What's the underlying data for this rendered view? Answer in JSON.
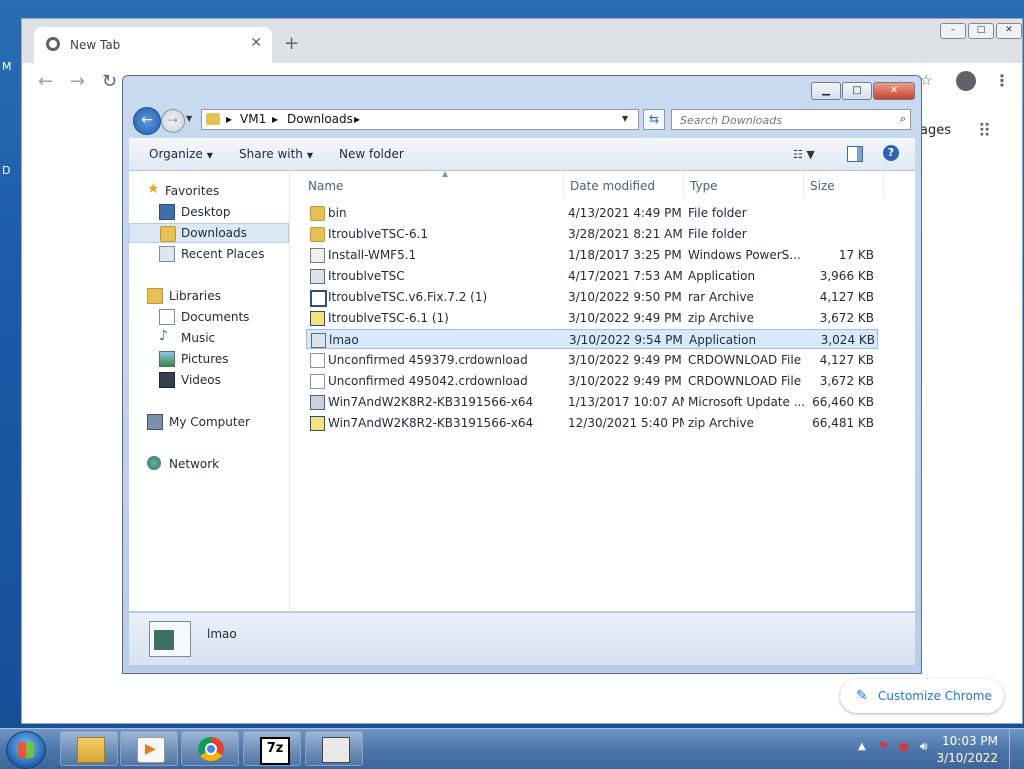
{
  "desktop": {
    "edge_letters": [
      "M",
      "D"
    ]
  },
  "chrome": {
    "tab_title": "New Tab",
    "tab_close": "✕",
    "new_tab": "+",
    "images_link": "ages",
    "customize_label": "Customize Chrome",
    "window_buttons": [
      "–",
      "□",
      "✕"
    ]
  },
  "explorer": {
    "window_buttons": {
      "minimize": "▁",
      "maximize": "□",
      "close": "✕"
    },
    "breadcrumb": [
      "VM1",
      "Downloads"
    ],
    "search_placeholder": "Search Downloads",
    "commands": {
      "organize": "Organize",
      "share_with": "Share with",
      "new_folder": "New folder"
    },
    "help": "?",
    "nav": {
      "favorites": "Favorites",
      "desktop": "Desktop",
      "downloads": "Downloads",
      "recent_places": "Recent Places",
      "libraries": "Libraries",
      "documents": "Documents",
      "music": "Music",
      "pictures": "Pictures",
      "videos": "Videos",
      "my_computer": "My Computer",
      "network": "Network"
    },
    "columns": {
      "name": "Name",
      "date": "Date modified",
      "type": "Type",
      "size": "Size"
    },
    "files": [
      {
        "name": "bin",
        "date": "4/13/2021 4:49 PM",
        "type": "File folder",
        "size": "",
        "icon": "folder-icon"
      },
      {
        "name": "ItroublveTSC-6.1",
        "date": "3/28/2021 8:21 AM",
        "type": "File folder",
        "size": "",
        "icon": "folder-icon"
      },
      {
        "name": "Install-WMF5.1",
        "date": "1/18/2017 3:25 PM",
        "type": "Windows PowerS...",
        "size": "17 KB",
        "icon": "powershell-icon"
      },
      {
        "name": "ItroublveTSC",
        "date": "4/17/2021 7:53 AM",
        "type": "Application",
        "size": "3,966 KB",
        "icon": "app-icon"
      },
      {
        "name": "ItroublveTSC.v6.Fix.7.2 (1)",
        "date": "3/10/2022 9:50 PM",
        "type": "rar Archive",
        "size": "4,127 KB",
        "icon": "rar-icon"
      },
      {
        "name": "ItroublveTSC-6.1 (1)",
        "date": "3/10/2022 9:49 PM",
        "type": "zip Archive",
        "size": "3,672 KB",
        "icon": "zip-icon"
      },
      {
        "name": "lmao",
        "date": "3/10/2022 9:54 PM",
        "type": "Application",
        "size": "3,024 KB",
        "icon": "app-icon"
      },
      {
        "name": "Unconfirmed 459379.crdownload",
        "date": "3/10/2022 9:49 PM",
        "type": "CRDOWNLOAD File",
        "size": "4,127 KB",
        "icon": "file-icon"
      },
      {
        "name": "Unconfirmed 495042.crdownload",
        "date": "3/10/2022 9:49 PM",
        "type": "CRDOWNLOAD File",
        "size": "3,672 KB",
        "icon": "file-icon"
      },
      {
        "name": "Win7AndW2K8R2-KB3191566-x64",
        "date": "1/13/2017 10:07 AM",
        "type": "Microsoft Update ...",
        "size": "66,460 KB",
        "icon": "msu-icon"
      },
      {
        "name": "Win7AndW2K8R2-KB3191566-x64",
        "date": "12/30/2021 5:40 PM",
        "type": "zip Archive",
        "size": "66,481 KB",
        "icon": "zip-icon"
      }
    ],
    "details_name": "lmao"
  },
  "taskbar": {
    "zip_label": "7z",
    "clock_time": "10:03 PM",
    "clock_date": "3/10/2022"
  }
}
